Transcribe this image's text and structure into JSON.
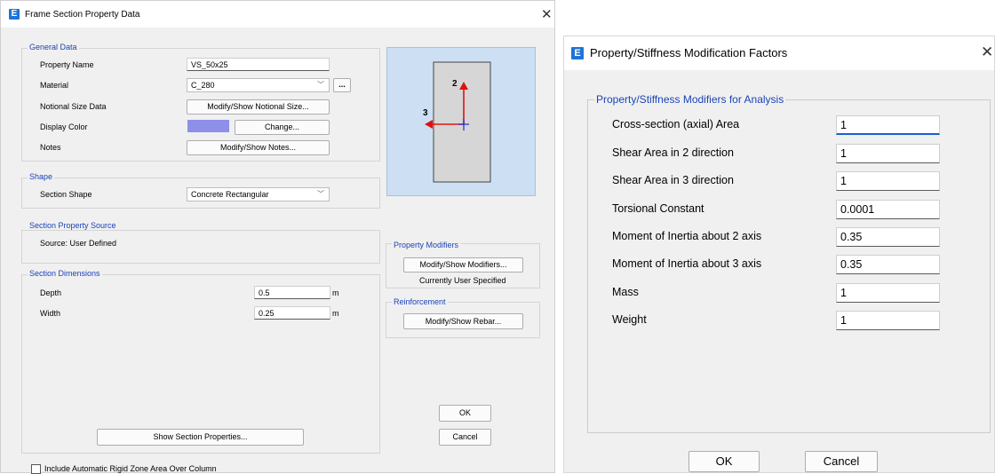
{
  "left": {
    "title": "Frame Section Property Data",
    "close_icon": "close-icon",
    "general": {
      "title": "General Data",
      "property_name_label": "Property Name",
      "property_name_value": "VS_50x25",
      "material_label": "Material",
      "material_value": "C_280",
      "material_more_button": "...",
      "notional_label": "Notional Size Data",
      "notional_button": "Modify/Show Notional Size...",
      "display_color_label": "Display Color",
      "display_color_swatch": "#8e8fe9",
      "change_button": "Change...",
      "notes_label": "Notes",
      "notes_button": "Modify/Show Notes..."
    },
    "shape": {
      "title": "Shape",
      "section_shape_label": "Section Shape",
      "section_shape_value": "Concrete Rectangular"
    },
    "preview": {
      "axis2_label": "2",
      "axis3_label": "3"
    },
    "source": {
      "title": "Section Property Source",
      "source_text": "Source:  User Defined"
    },
    "modifiers": {
      "title": "Property Modifiers",
      "button": "Modify/Show Modifiers...",
      "status": "Currently User Specified"
    },
    "dimensions": {
      "title": "Section Dimensions",
      "depth_label": "Depth",
      "depth_value": "0.5",
      "depth_unit": "m",
      "width_label": "Width",
      "width_value": "0.25",
      "width_unit": "m"
    },
    "reinforcement": {
      "title": "Reinforcement",
      "button": "Modify/Show Rebar..."
    },
    "show_props_button": "Show Section Properties...",
    "ok_button": "OK",
    "cancel_button": "Cancel",
    "rigid_zone_label": "Include Automatic Rigid Zone Area Over Column"
  },
  "right": {
    "title": "Property/Stiffness Modification Factors",
    "group_title": "Property/Stiffness Modifiers for Analysis",
    "rows": [
      {
        "label": "Cross-section (axial) Area",
        "value": "1"
      },
      {
        "label": "Shear Area in 2 direction",
        "value": "1"
      },
      {
        "label": "Shear Area in 3 direction",
        "value": "1"
      },
      {
        "label": "Torsional Constant",
        "value": "0.0001"
      },
      {
        "label": "Moment of Inertia about 2 axis",
        "value": "0.35"
      },
      {
        "label": "Moment of Inertia about 3 axis",
        "value": "0.35"
      },
      {
        "label": "Mass",
        "value": "1"
      },
      {
        "label": "Weight",
        "value": "1"
      }
    ],
    "ok_button": "OK",
    "cancel_button": "Cancel"
  }
}
